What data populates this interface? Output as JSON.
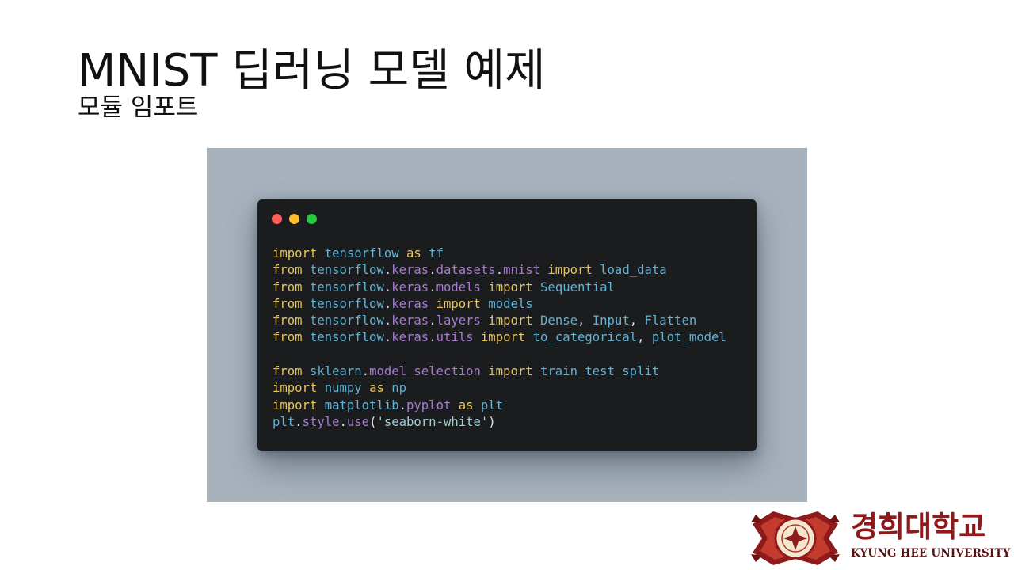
{
  "slide": {
    "title": "MNIST 딥러닝 모델 예제",
    "subtitle": "모듈 임포트"
  },
  "code_window": {
    "dot_colors": [
      "#ff5f56",
      "#ffbd2e",
      "#27c93f"
    ],
    "lines": [
      [
        {
          "t": "import",
          "c": "kw"
        },
        {
          "t": " ",
          "c": "punct"
        },
        {
          "t": "tensorflow",
          "c": "mod"
        },
        {
          "t": " ",
          "c": "punct"
        },
        {
          "t": "as",
          "c": "kw"
        },
        {
          "t": " ",
          "c": "punct"
        },
        {
          "t": "tf",
          "c": "name"
        }
      ],
      [
        {
          "t": "from",
          "c": "kw"
        },
        {
          "t": " ",
          "c": "punct"
        },
        {
          "t": "tensorflow",
          "c": "mod"
        },
        {
          "t": ".",
          "c": "punct"
        },
        {
          "t": "keras",
          "c": "sub"
        },
        {
          "t": ".",
          "c": "punct"
        },
        {
          "t": "datasets",
          "c": "sub"
        },
        {
          "t": ".",
          "c": "punct"
        },
        {
          "t": "mnist",
          "c": "sub"
        },
        {
          "t": " ",
          "c": "punct"
        },
        {
          "t": "import",
          "c": "kw"
        },
        {
          "t": " ",
          "c": "punct"
        },
        {
          "t": "load_data",
          "c": "name"
        }
      ],
      [
        {
          "t": "from",
          "c": "kw"
        },
        {
          "t": " ",
          "c": "punct"
        },
        {
          "t": "tensorflow",
          "c": "mod"
        },
        {
          "t": ".",
          "c": "punct"
        },
        {
          "t": "keras",
          "c": "sub"
        },
        {
          "t": ".",
          "c": "punct"
        },
        {
          "t": "models",
          "c": "sub"
        },
        {
          "t": " ",
          "c": "punct"
        },
        {
          "t": "import",
          "c": "kw"
        },
        {
          "t": " ",
          "c": "punct"
        },
        {
          "t": "Sequential",
          "c": "name"
        }
      ],
      [
        {
          "t": "from",
          "c": "kw"
        },
        {
          "t": " ",
          "c": "punct"
        },
        {
          "t": "tensorflow",
          "c": "mod"
        },
        {
          "t": ".",
          "c": "punct"
        },
        {
          "t": "keras",
          "c": "sub"
        },
        {
          "t": " ",
          "c": "punct"
        },
        {
          "t": "import",
          "c": "kw"
        },
        {
          "t": " ",
          "c": "punct"
        },
        {
          "t": "models",
          "c": "name"
        }
      ],
      [
        {
          "t": "from",
          "c": "kw"
        },
        {
          "t": " ",
          "c": "punct"
        },
        {
          "t": "tensorflow",
          "c": "mod"
        },
        {
          "t": ".",
          "c": "punct"
        },
        {
          "t": "keras",
          "c": "sub"
        },
        {
          "t": ".",
          "c": "punct"
        },
        {
          "t": "layers",
          "c": "sub"
        },
        {
          "t": " ",
          "c": "punct"
        },
        {
          "t": "import",
          "c": "kw"
        },
        {
          "t": " ",
          "c": "punct"
        },
        {
          "t": "Dense",
          "c": "name"
        },
        {
          "t": ", ",
          "c": "punct"
        },
        {
          "t": "Input",
          "c": "name"
        },
        {
          "t": ", ",
          "c": "punct"
        },
        {
          "t": "Flatten",
          "c": "name"
        }
      ],
      [
        {
          "t": "from",
          "c": "kw"
        },
        {
          "t": " ",
          "c": "punct"
        },
        {
          "t": "tensorflow",
          "c": "mod"
        },
        {
          "t": ".",
          "c": "punct"
        },
        {
          "t": "keras",
          "c": "sub"
        },
        {
          "t": ".",
          "c": "punct"
        },
        {
          "t": "utils",
          "c": "sub"
        },
        {
          "t": " ",
          "c": "punct"
        },
        {
          "t": "import",
          "c": "kw"
        },
        {
          "t": " ",
          "c": "punct"
        },
        {
          "t": "to_categorical",
          "c": "name"
        },
        {
          "t": ", ",
          "c": "punct"
        },
        {
          "t": "plot_model",
          "c": "name"
        }
      ],
      [],
      [
        {
          "t": "from",
          "c": "kw"
        },
        {
          "t": " ",
          "c": "punct"
        },
        {
          "t": "sklearn",
          "c": "mod"
        },
        {
          "t": ".",
          "c": "punct"
        },
        {
          "t": "model_selection",
          "c": "sub"
        },
        {
          "t": " ",
          "c": "punct"
        },
        {
          "t": "import",
          "c": "kw"
        },
        {
          "t": " ",
          "c": "punct"
        },
        {
          "t": "train_test_split",
          "c": "name"
        }
      ],
      [
        {
          "t": "import",
          "c": "kw"
        },
        {
          "t": " ",
          "c": "punct"
        },
        {
          "t": "numpy",
          "c": "mod"
        },
        {
          "t": " ",
          "c": "punct"
        },
        {
          "t": "as",
          "c": "kw"
        },
        {
          "t": " ",
          "c": "punct"
        },
        {
          "t": "np",
          "c": "name"
        }
      ],
      [
        {
          "t": "import",
          "c": "kw"
        },
        {
          "t": " ",
          "c": "punct"
        },
        {
          "t": "matplotlib",
          "c": "mod"
        },
        {
          "t": ".",
          "c": "punct"
        },
        {
          "t": "pyplot",
          "c": "sub"
        },
        {
          "t": " ",
          "c": "punct"
        },
        {
          "t": "as",
          "c": "kw"
        },
        {
          "t": " ",
          "c": "punct"
        },
        {
          "t": "plt",
          "c": "name"
        }
      ],
      [
        {
          "t": "plt",
          "c": "mod"
        },
        {
          "t": ".",
          "c": "punct"
        },
        {
          "t": "style",
          "c": "sub"
        },
        {
          "t": ".",
          "c": "punct"
        },
        {
          "t": "use",
          "c": "sub"
        },
        {
          "t": "(",
          "c": "punct"
        },
        {
          "t": "'seaborn-white'",
          "c": "str"
        },
        {
          "t": ")",
          "c": "punct"
        }
      ]
    ]
  },
  "logo": {
    "name_ko": "경희대학교",
    "name_en": "KYUNG HEE UNIVERSITY",
    "brand_color": "#8e1a1c"
  }
}
